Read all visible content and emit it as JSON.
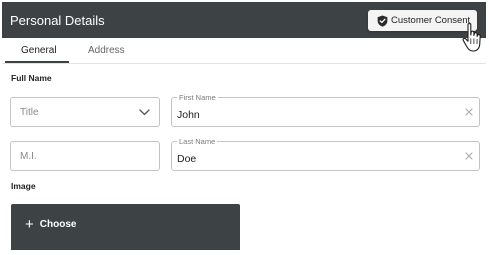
{
  "header": {
    "title": "Personal Details",
    "consent_button_label": "Customer Consent"
  },
  "tabs": [
    {
      "label": "General",
      "active": true
    },
    {
      "label": "Address",
      "active": false
    }
  ],
  "full_name": {
    "section_label": "Full Name",
    "title_select": {
      "placeholder": "Title"
    },
    "mi_field": {
      "placeholder": "M.I."
    },
    "first_name": {
      "label": "First Name",
      "value": "John"
    },
    "last_name": {
      "label": "Last Name",
      "value": "Doe"
    }
  },
  "image": {
    "section_label": "Image",
    "choose_label": "Choose"
  },
  "icons": {
    "consent": "shield-check-icon",
    "dropdown": "chevron-down-icon",
    "clear": "close-icon",
    "add": "plus-icon",
    "cursor": "hand-pointer-icon"
  },
  "colors": {
    "header_bg": "#3d4245",
    "button_bg": "#f4f4f4",
    "border": "#c4c4c4"
  }
}
